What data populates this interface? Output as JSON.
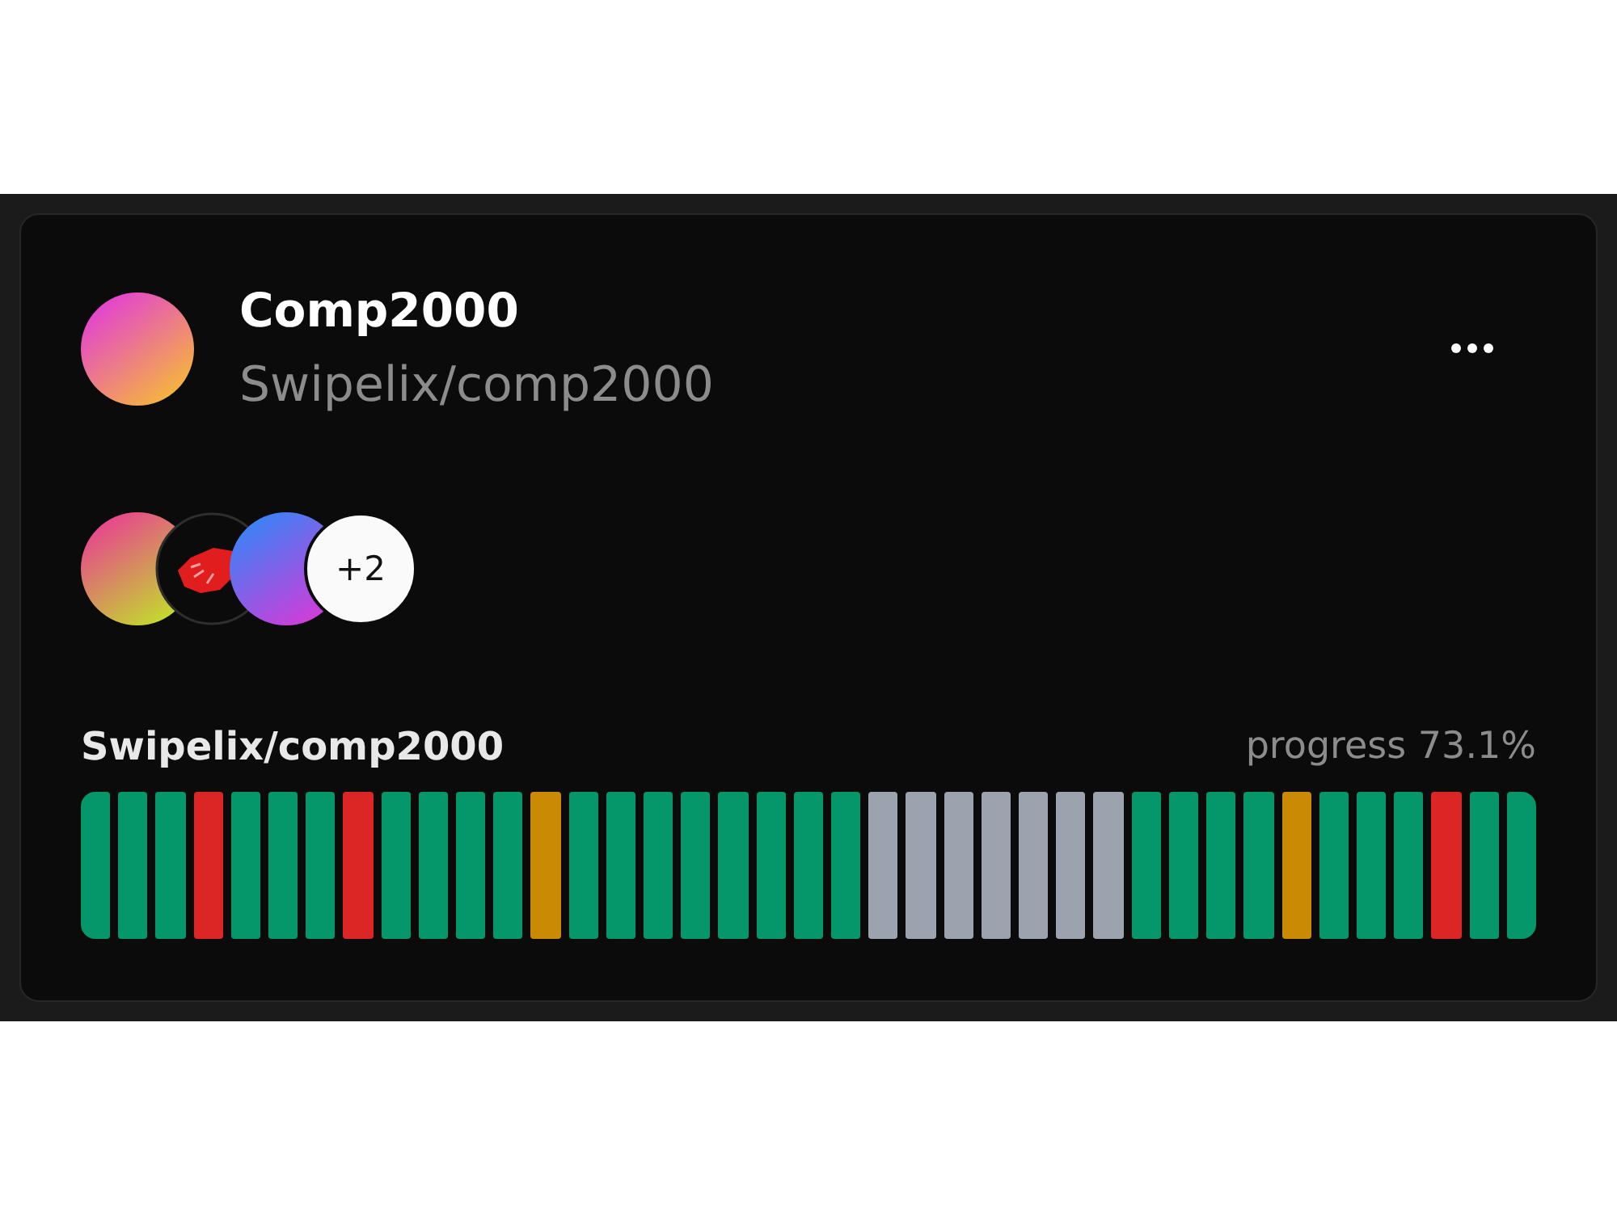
{
  "project": {
    "title": "Comp2000",
    "subtitle": "Swipelix/comp2000"
  },
  "members": {
    "avatars": [
      {
        "kind": "gradient"
      },
      {
        "kind": "picture"
      },
      {
        "kind": "gradient"
      }
    ],
    "more": "+2"
  },
  "activity": {
    "label": "Swipelix/comp2000",
    "progress": "progress 73.1%",
    "segments": [
      {
        "color": "#059669"
      },
      {
        "color": "#059669"
      },
      {
        "color": "#059669"
      },
      {
        "color": "#dc2626"
      },
      {
        "color": "#059669"
      },
      {
        "color": "#059669"
      },
      {
        "color": "#059669"
      },
      {
        "color": "#dc2626"
      },
      {
        "color": "#059669"
      },
      {
        "color": "#059669"
      },
      {
        "color": "#059669"
      },
      {
        "color": "#059669"
      },
      {
        "color": "#ca8a04"
      },
      {
        "color": "#059669"
      },
      {
        "color": "#059669"
      },
      {
        "color": "#059669"
      },
      {
        "color": "#059669"
      },
      {
        "color": "#059669"
      },
      {
        "color": "#059669"
      },
      {
        "color": "#059669"
      },
      {
        "color": "#059669"
      },
      {
        "color": "#9ca3af"
      },
      {
        "color": "#9ca3af"
      },
      {
        "color": "#9ca3af"
      },
      {
        "color": "#9ca3af"
      },
      {
        "color": "#9ca3af"
      },
      {
        "color": "#9ca3af"
      },
      {
        "color": "#9ca3af"
      },
      {
        "color": "#059669"
      },
      {
        "color": "#059669"
      },
      {
        "color": "#059669"
      },
      {
        "color": "#059669"
      },
      {
        "color": "#ca8a04"
      },
      {
        "color": "#059669"
      },
      {
        "color": "#059669"
      },
      {
        "color": "#059669"
      },
      {
        "color": "#dc2626"
      },
      {
        "color": "#059669"
      },
      {
        "color": "#059669"
      }
    ]
  }
}
